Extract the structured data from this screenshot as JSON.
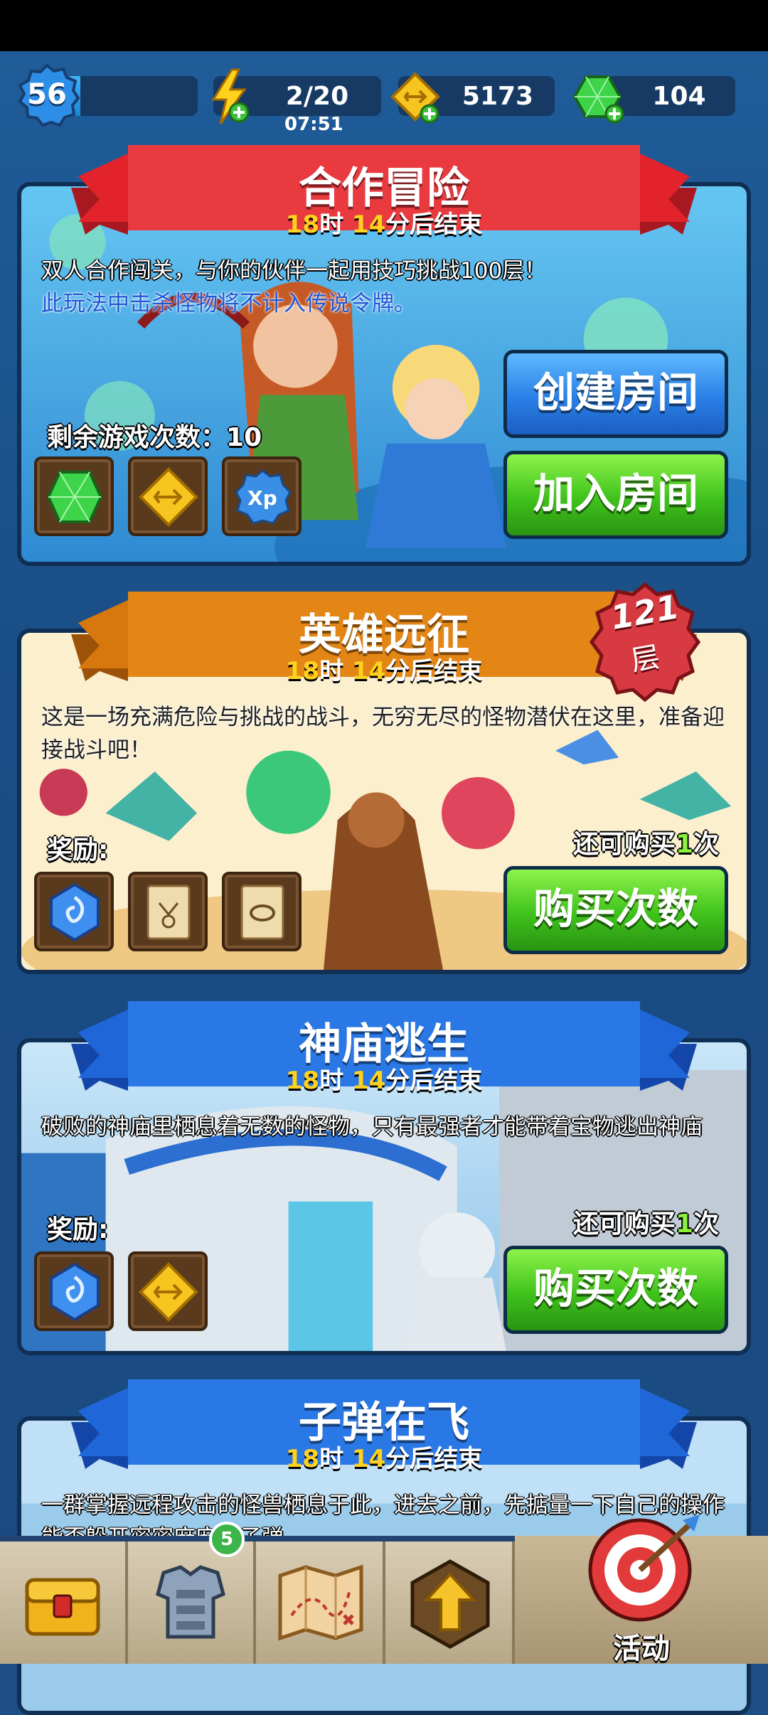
{
  "player": {
    "level": "56",
    "xp_fraction": 0.12
  },
  "resources": {
    "energy": "2/20",
    "energy_timer": "07:51",
    "gold": "5173",
    "gems": "104"
  },
  "events": [
    {
      "title": "合作冒险",
      "time_hours": "18",
      "time_h_unit": "时",
      "time_minutes": "14",
      "time_suffix": "分后结束",
      "desc_line1": "双人合作闯关，与你的伙伴一起用技巧挑战100层！",
      "desc_line2": "此玩法中击杀怪物将不计入传说令牌。",
      "plays_label": "剩余游戏次数：",
      "plays_value": "10",
      "reward_icons": [
        "green-gem-icon",
        "gold-coin-icon",
        "xp-icon"
      ],
      "create_room": "创建房间",
      "join_room": "加入房间"
    },
    {
      "title": "英雄远征",
      "badge_number": "121",
      "badge_unit": "层",
      "time_hours": "18",
      "time_h_unit": "时",
      "time_minutes": "14",
      "time_suffix": "分后结束",
      "desc": "这是一场充满危险与挑战的战斗，无穷无尽的怪物潜伏在这里，准备迎接战斗吧！",
      "reward_label": "奖励:",
      "reward_icons": [
        "blue-stone-icon",
        "scroll-amulet-icon",
        "scroll-ring-icon"
      ],
      "buy_left_prefix": "还可购买",
      "buy_left_count": "1",
      "buy_left_suffix": "次",
      "buy_button": "购买次数"
    },
    {
      "title": "神庙逃生",
      "time_hours": "18",
      "time_h_unit": "时",
      "time_minutes": "14",
      "time_suffix": "分后结束",
      "desc": "破败的神庙里栖息着无数的怪物，只有最强者才能带着宝物逃出神庙",
      "reward_label": "奖励:",
      "reward_icons": [
        "blue-stone-icon",
        "gold-coin-icon"
      ],
      "buy_left_prefix": "还可购买",
      "buy_left_count": "1",
      "buy_left_suffix": "次",
      "buy_button": "购买次数"
    },
    {
      "title": "子弹在飞",
      "time_hours": "18",
      "time_h_unit": "时",
      "time_minutes": "14",
      "time_suffix": "分后结束",
      "desc": "一群掌握远程攻击的怪兽栖息于此，进去之前，先掂量一下自己的操作能否躲开密密麻麻的子弹"
    }
  ],
  "nav": {
    "items": [
      "chest-icon",
      "armor-icon",
      "map-icon",
      "upgrade-arrow-icon"
    ],
    "equipment_badge": "5",
    "active_label": "活动"
  },
  "colors": {
    "accent_yellow": "#ffd21f",
    "button_green": "#3fc21b",
    "button_blue": "#2a7fe6"
  }
}
